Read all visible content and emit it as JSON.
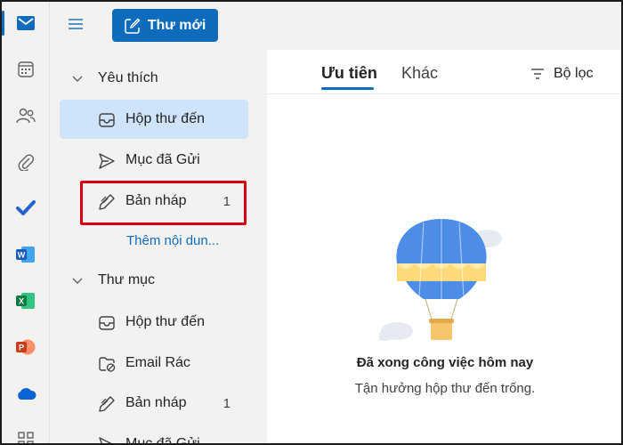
{
  "app": {
    "accent": "#0f6cbd",
    "selected_bg": "#cfe4fa",
    "highlight_color": "#d7000f"
  },
  "rail": {
    "items": [
      {
        "icon": "mail-icon",
        "active": true
      },
      {
        "icon": "calendar-icon"
      },
      {
        "icon": "people-icon"
      },
      {
        "icon": "attachment-icon"
      },
      {
        "icon": "todo-icon"
      },
      {
        "icon": "word-icon"
      },
      {
        "icon": "excel-icon"
      },
      {
        "icon": "powerpoint-icon"
      },
      {
        "icon": "onedrive-icon"
      },
      {
        "icon": "more-apps-icon"
      }
    ]
  },
  "toolbar": {
    "new_mail_label": "Thư mới"
  },
  "favorites": {
    "title": "Yêu thích",
    "items": [
      {
        "label": "Hộp thư đến",
        "icon": "inbox-icon",
        "selected": true
      },
      {
        "label": "Mục đã Gửi",
        "icon": "sent-icon"
      },
      {
        "label": "Bản nháp",
        "icon": "draft-icon",
        "count": "1"
      }
    ],
    "more_label": "Thêm nội dun..."
  },
  "folders": {
    "title": "Thư mục",
    "items": [
      {
        "label": "Hộp thư đến",
        "icon": "inbox-icon"
      },
      {
        "label": "Email Rác",
        "icon": "junk-icon"
      },
      {
        "label": "Bản nháp",
        "icon": "draft-icon",
        "count": "1"
      },
      {
        "label": "Mục đã Gửi",
        "icon": "sent-icon"
      }
    ]
  },
  "main": {
    "tabs": [
      {
        "label": "Ưu tiên",
        "active": true
      },
      {
        "label": "Khác"
      }
    ],
    "filter_label": "Bộ lọc",
    "empty_state": {
      "title": "Đã xong công việc hôm nay",
      "subtitle": "Tận hưởng hộp thư đến trống.",
      "illustration": "hot-air-balloon"
    }
  }
}
